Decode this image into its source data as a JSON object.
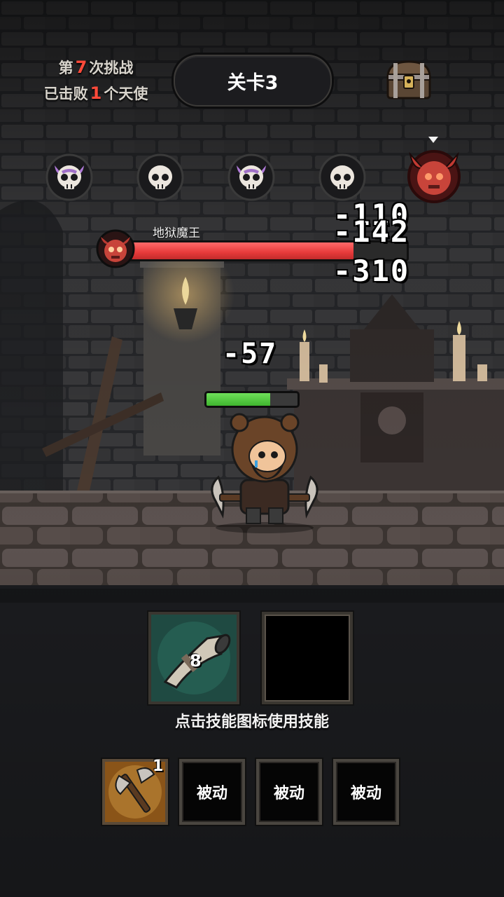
{
  "header": {
    "challenge_prefix": "第",
    "challenge_count": "7",
    "challenge_suffix": "次挑战",
    "defeated_prefix": "已击败",
    "defeated_count": "1",
    "defeated_suffix": "个天使",
    "level_label": "关卡3",
    "chest_icon": "treasure-chest-icon"
  },
  "waves": {
    "icons": [
      "purple-horned-skull-icon",
      "skull-icon",
      "purple-horned-skull-icon",
      "skull-icon",
      "red-demon-boss-icon"
    ],
    "current_index": 4
  },
  "boss": {
    "name": "地狱魔王",
    "hp_fraction": 0.81,
    "icon": "red-demon-boss-icon",
    "bar_color": "#e63a3a"
  },
  "damage_numbers": [
    "-110",
    "-142",
    "-310",
    "-57"
  ],
  "hero": {
    "hp_fraction": 0.7,
    "bar_color": "#3fb52e"
  },
  "active_skills": [
    {
      "icon": "war-horn-icon",
      "count": "8"
    },
    {
      "icon": "",
      "count": ""
    }
  ],
  "hint": "点击技能图标使用技能",
  "passives": [
    {
      "icon": "double-axe-icon",
      "level": "1",
      "label": ""
    },
    {
      "label": "被动"
    },
    {
      "label": "被动"
    },
    {
      "label": "被动"
    }
  ]
}
